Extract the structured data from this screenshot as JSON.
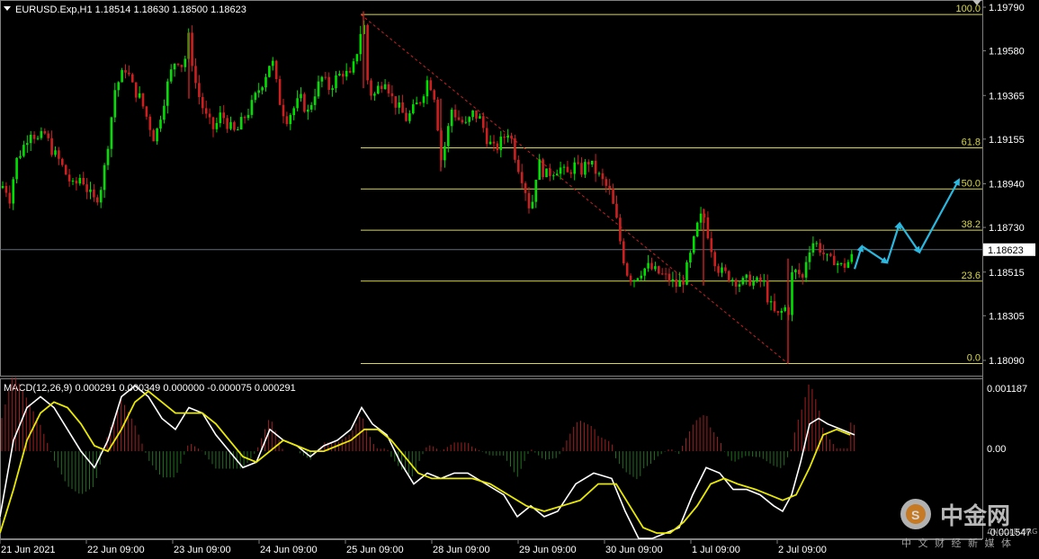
{
  "header": {
    "symbol_line": "EURUSD.Exp,H1  1.18514 1.18630 1.18500 1.18623",
    "current_price": "1.18623"
  },
  "price_axis": [
    "1.19790",
    "1.19580",
    "1.19365",
    "1.19155",
    "1.18940",
    "1.18730",
    "1.18515",
    "1.18305",
    "1.18090"
  ],
  "fibonacci_levels": [
    "100.0",
    "61.8",
    "50.0",
    "38.2",
    "23.6",
    "0.0"
  ],
  "macd": {
    "title": "MACD(12,26,9) 0.000291 0.000349 0.000000 -0.000075 0.000291",
    "axis": [
      "0.001187",
      "0.00",
      "-0.001547"
    ]
  },
  "time_axis": [
    "21 Jun 2021",
    "22 Jun 09:00",
    "23 Jun 09:00",
    "24 Jun 09:00",
    "25 Jun 09:00",
    "28 Jun 09:00",
    "29 Jun 09:00",
    "30 Jun 09:00",
    "1 Jul 09:00",
    "2 Jul 09:00"
  ],
  "watermark": {
    "name": "中金网",
    "subtitle": "中 文 财 经 新 媒 体",
    "domain": "CNGOLD.ORG"
  },
  "colors": {
    "bull": "#00e000",
    "bear": "#cc2020",
    "fib": "#d8d84a",
    "macd_line": "#ffffff",
    "signal_line": "#e8e800",
    "hist_pos": "#a02020",
    "hist_neg": "#207020",
    "projection": "#2ab8e0"
  },
  "chart_data": {
    "type": "candlestick",
    "symbol": "EURUSD.Exp",
    "timeframe": "H1",
    "ohlc_last": {
      "open": 1.18514,
      "high": 1.1863,
      "low": 1.185,
      "close": 1.18623
    },
    "price_range": [
      1.1801,
      1.1988
    ],
    "fib_retracement": {
      "high": 1.19755,
      "low": 1.18075,
      "levels": [
        100.0,
        61.8,
        50.0,
        38.2,
        23.6,
        0.0
      ]
    },
    "macd_range": [
      -0.001547,
      0.001187
    ],
    "macd_last": {
      "macd": 0.000291,
      "signal": 0.000349
    },
    "close_path": [
      [
        0,
        1.189
      ],
      [
        5,
        1.1895
      ],
      [
        10,
        1.1885
      ],
      [
        18,
        1.1905
      ],
      [
        26,
        1.1912
      ],
      [
        34,
        1.192
      ],
      [
        42,
        1.1915
      ],
      [
        50,
        1.1918
      ],
      [
        58,
        1.191
      ],
      [
        66,
        1.1905
      ],
      [
        74,
        1.1898
      ],
      [
        82,
        1.1892
      ],
      [
        90,
        1.1898
      ],
      [
        98,
        1.189
      ],
      [
        106,
        1.1885
      ],
      [
        114,
        1.1895
      ],
      [
        122,
        1.192
      ],
      [
        128,
        1.194
      ],
      [
        134,
        1.1945
      ],
      [
        140,
        1.195
      ],
      [
        148,
        1.194
      ],
      [
        156,
        1.1935
      ],
      [
        164,
        1.1925
      ],
      [
        172,
        1.1915
      ],
      [
        180,
        1.193
      ],
      [
        188,
        1.1945
      ],
      [
        196,
        1.1955
      ],
      [
        204,
        1.195
      ],
      [
        210,
        1.1965
      ],
      [
        216,
        1.1945
      ],
      [
        222,
        1.1935
      ],
      [
        230,
        1.1925
      ],
      [
        238,
        1.192
      ],
      [
        246,
        1.1928
      ],
      [
        254,
        1.1922
      ],
      [
        262,
        1.1918
      ],
      [
        270,
        1.1925
      ],
      [
        278,
        1.193
      ],
      [
        286,
        1.1938
      ],
      [
        294,
        1.1945
      ],
      [
        302,
        1.1955
      ],
      [
        310,
        1.1935
      ],
      [
        318,
        1.1925
      ],
      [
        326,
        1.193
      ],
      [
        334,
        1.1935
      ],
      [
        342,
        1.1928
      ],
      [
        350,
        1.1938
      ],
      [
        358,
        1.1945
      ],
      [
        366,
        1.194
      ],
      [
        374,
        1.1945
      ],
      [
        382,
        1.1948
      ],
      [
        390,
        1.1945
      ],
      [
        398,
        1.196
      ],
      [
        404,
        1.1975
      ],
      [
        408,
        1.1945
      ],
      [
        414,
        1.1935
      ],
      [
        420,
        1.194
      ],
      [
        428,
        1.1945
      ],
      [
        436,
        1.1935
      ],
      [
        444,
        1.193
      ],
      [
        452,
        1.1925
      ],
      [
        460,
        1.193
      ],
      [
        468,
        1.1935
      ],
      [
        476,
        1.1945
      ],
      [
        484,
        1.1935
      ],
      [
        490,
        1.1905
      ],
      [
        496,
        1.1915
      ],
      [
        502,
        1.193
      ],
      [
        510,
        1.1925
      ],
      [
        518,
        1.1922
      ],
      [
        526,
        1.1928
      ],
      [
        534,
        1.1925
      ],
      [
        542,
        1.1915
      ],
      [
        550,
        1.191
      ],
      [
        558,
        1.1915
      ],
      [
        566,
        1.192
      ],
      [
        574,
        1.1905
      ],
      [
        582,
        1.1895
      ],
      [
        590,
        1.188
      ],
      [
        598,
        1.1905
      ],
      [
        606,
        1.1898
      ],
      [
        614,
        1.19
      ],
      [
        622,
        1.1902
      ],
      [
        630,
        1.1898
      ],
      [
        638,
        1.1903
      ],
      [
        646,
        1.19
      ],
      [
        654,
        1.1905
      ],
      [
        662,
        1.19
      ],
      [
        670,
        1.1895
      ],
      [
        678,
        1.189
      ],
      [
        686,
        1.1875
      ],
      [
        692,
        1.186
      ],
      [
        698,
        1.185
      ],
      [
        704,
        1.1848
      ],
      [
        712,
        1.1852
      ],
      [
        720,
        1.1854
      ],
      [
        728,
        1.1852
      ],
      [
        736,
        1.185
      ],
      [
        744,
        1.1848
      ],
      [
        752,
        1.1845
      ],
      [
        760,
        1.1848
      ],
      [
        768,
        1.186
      ],
      [
        776,
        1.1875
      ],
      [
        782,
        1.188
      ],
      [
        788,
        1.1868
      ],
      [
        794,
        1.1858
      ],
      [
        800,
        1.1852
      ],
      [
        808,
        1.185
      ],
      [
        816,
        1.1848
      ],
      [
        824,
        1.1846
      ],
      [
        832,
        1.1848
      ],
      [
        840,
        1.1846
      ],
      [
        848,
        1.1848
      ],
      [
        854,
        1.1838
      ],
      [
        860,
        1.1832
      ],
      [
        866,
        1.183
      ],
      [
        872,
        1.1835
      ],
      [
        876,
        1.183
      ],
      [
        880,
        1.185
      ],
      [
        886,
        1.1852
      ],
      [
        892,
        1.1848
      ],
      [
        898,
        1.1862
      ],
      [
        904,
        1.1866
      ],
      [
        910,
        1.1864
      ],
      [
        916,
        1.186
      ],
      [
        922,
        1.1856
      ],
      [
        928,
        1.1858
      ],
      [
        934,
        1.1854
      ],
      [
        940,
        1.1855
      ],
      [
        946,
        1.1858
      ],
      [
        952,
        1.1862
      ]
    ],
    "projection": [
      [
        950,
        1.1853
      ],
      [
        958,
        1.1864
      ],
      [
        986,
        1.1856
      ],
      [
        1000,
        1.1875
      ],
      [
        1022,
        1.1861
      ],
      [
        1066,
        1.1896
      ]
    ],
    "macd_path": [
      [
        0,
        -0.0012
      ],
      [
        15,
        0.0002
      ],
      [
        30,
        0.0008
      ],
      [
        45,
        0.001
      ],
      [
        60,
        0.0008
      ],
      [
        75,
        0.0004
      ],
      [
        90,
        0.0
      ],
      [
        105,
        -0.0003
      ],
      [
        120,
        0.0002
      ],
      [
        135,
        0.001
      ],
      [
        150,
        0.0012
      ],
      [
        165,
        0.001
      ],
      [
        180,
        0.0006
      ],
      [
        195,
        0.0004
      ],
      [
        210,
        0.0008
      ],
      [
        225,
        0.0007
      ],
      [
        240,
        0.0003
      ],
      [
        255,
        0.0
      ],
      [
        270,
        -0.0003
      ],
      [
        285,
        -0.0002
      ],
      [
        300,
        0.0004
      ],
      [
        315,
        0.0002
      ],
      [
        330,
        0.0001
      ],
      [
        345,
        -0.0001
      ],
      [
        360,
        0.0001
      ],
      [
        375,
        0.0002
      ],
      [
        390,
        0.0004
      ],
      [
        402,
        0.0008
      ],
      [
        414,
        0.0005
      ],
      [
        430,
        0.0003
      ],
      [
        445,
        -0.0002
      ],
      [
        460,
        -0.0006
      ],
      [
        475,
        -0.0004
      ],
      [
        490,
        -0.0005
      ],
      [
        505,
        -0.0004
      ],
      [
        520,
        -0.0004
      ],
      [
        540,
        -0.0006
      ],
      [
        560,
        -0.0008
      ],
      [
        575,
        -0.0012
      ],
      [
        590,
        -0.001
      ],
      [
        605,
        -0.0012
      ],
      [
        620,
        -0.0011
      ],
      [
        640,
        -0.0006
      ],
      [
        660,
        -0.0004
      ],
      [
        680,
        -0.0005
      ],
      [
        695,
        -0.0011
      ],
      [
        710,
        -0.0016
      ],
      [
        725,
        -0.0016
      ],
      [
        740,
        -0.0015
      ],
      [
        755,
        -0.0014
      ],
      [
        770,
        -0.0008
      ],
      [
        785,
        -0.0003
      ],
      [
        800,
        -0.0004
      ],
      [
        815,
        -0.0007
      ],
      [
        830,
        -0.0007
      ],
      [
        845,
        -0.0008
      ],
      [
        860,
        -0.001
      ],
      [
        870,
        -0.0011
      ],
      [
        880,
        -0.0008
      ],
      [
        890,
        -0.0002
      ],
      [
        900,
        0.0005
      ],
      [
        910,
        0.0006
      ],
      [
        920,
        0.0005
      ],
      [
        935,
        0.0004
      ],
      [
        950,
        0.0003
      ]
    ],
    "signal_path": [
      [
        0,
        -0.0015
      ],
      [
        15,
        -0.0007
      ],
      [
        30,
        0.0002
      ],
      [
        45,
        0.0007
      ],
      [
        60,
        0.0009
      ],
      [
        75,
        0.0008
      ],
      [
        90,
        0.0005
      ],
      [
        105,
        0.0001
      ],
      [
        120,
        0.0
      ],
      [
        135,
        0.0004
      ],
      [
        150,
        0.0009
      ],
      [
        165,
        0.0011
      ],
      [
        180,
        0.0009
      ],
      [
        195,
        0.0007
      ],
      [
        210,
        0.0007
      ],
      [
        225,
        0.0007
      ],
      [
        240,
        0.0005
      ],
      [
        255,
        0.0002
      ],
      [
        270,
        -0.0001
      ],
      [
        285,
        -0.0002
      ],
      [
        300,
        0.0
      ],
      [
        315,
        0.0002
      ],
      [
        330,
        0.0001
      ],
      [
        345,
        0.0
      ],
      [
        360,
        0.0
      ],
      [
        375,
        0.0001
      ],
      [
        390,
        0.0002
      ],
      [
        405,
        0.0004
      ],
      [
        420,
        0.0004
      ],
      [
        435,
        0.0002
      ],
      [
        450,
        -0.0001
      ],
      [
        465,
        -0.0004
      ],
      [
        480,
        -0.0005
      ],
      [
        495,
        -0.0005
      ],
      [
        510,
        -0.0005
      ],
      [
        525,
        -0.0005
      ],
      [
        545,
        -0.0006
      ],
      [
        565,
        -0.0008
      ],
      [
        585,
        -0.001
      ],
      [
        605,
        -0.0011
      ],
      [
        625,
        -0.001
      ],
      [
        645,
        -0.0009
      ],
      [
        665,
        -0.0006
      ],
      [
        685,
        -0.0006
      ],
      [
        700,
        -0.001
      ],
      [
        715,
        -0.0014
      ],
      [
        730,
        -0.0015
      ],
      [
        745,
        -0.0015
      ],
      [
        760,
        -0.0013
      ],
      [
        775,
        -0.001
      ],
      [
        790,
        -0.0006
      ],
      [
        805,
        -0.0005
      ],
      [
        820,
        -0.0006
      ],
      [
        840,
        -0.0007
      ],
      [
        855,
        -0.0008
      ],
      [
        870,
        -0.0009
      ],
      [
        885,
        -0.0008
      ],
      [
        900,
        -0.0003
      ],
      [
        915,
        0.0003
      ],
      [
        930,
        0.0004
      ],
      [
        945,
        0.0003
      ]
    ]
  }
}
